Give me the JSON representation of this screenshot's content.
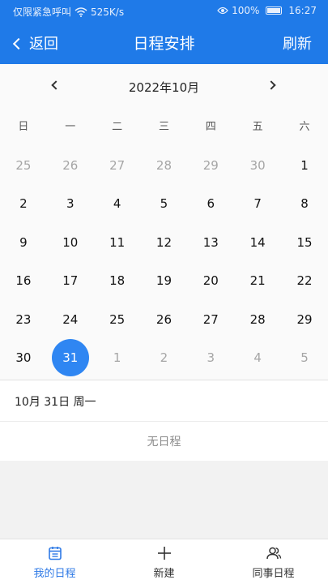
{
  "status_bar": {
    "carrier": "仅限紧急呼叫",
    "speed": "525K/s",
    "battery": "100%",
    "time": "16:27"
  },
  "header": {
    "back_label": "返回",
    "title": "日程安排",
    "refresh_label": "刷新"
  },
  "calendar": {
    "month_label": "2022年10月",
    "weekdays": [
      "日",
      "一",
      "二",
      "三",
      "四",
      "五",
      "六"
    ],
    "days": [
      {
        "d": "25",
        "other": true
      },
      {
        "d": "26",
        "other": true
      },
      {
        "d": "27",
        "other": true
      },
      {
        "d": "28",
        "other": true
      },
      {
        "d": "29",
        "other": true
      },
      {
        "d": "30",
        "other": true
      },
      {
        "d": "1"
      },
      {
        "d": "2"
      },
      {
        "d": "3"
      },
      {
        "d": "4"
      },
      {
        "d": "5"
      },
      {
        "d": "6"
      },
      {
        "d": "7"
      },
      {
        "d": "8"
      },
      {
        "d": "9"
      },
      {
        "d": "10"
      },
      {
        "d": "11"
      },
      {
        "d": "12"
      },
      {
        "d": "13"
      },
      {
        "d": "14"
      },
      {
        "d": "15"
      },
      {
        "d": "16"
      },
      {
        "d": "17"
      },
      {
        "d": "18"
      },
      {
        "d": "19"
      },
      {
        "d": "20"
      },
      {
        "d": "21"
      },
      {
        "d": "22"
      },
      {
        "d": "23"
      },
      {
        "d": "24"
      },
      {
        "d": "25"
      },
      {
        "d": "26"
      },
      {
        "d": "27"
      },
      {
        "d": "28"
      },
      {
        "d": "29"
      },
      {
        "d": "30"
      },
      {
        "d": "31",
        "selected": true
      },
      {
        "d": "1",
        "other": true
      },
      {
        "d": "2",
        "other": true
      },
      {
        "d": "3",
        "other": true
      },
      {
        "d": "4",
        "other": true
      },
      {
        "d": "5",
        "other": true
      }
    ]
  },
  "schedule": {
    "date_label": "10月 31日 周一",
    "empty_text": "无日程"
  },
  "bottom_nav": {
    "items": [
      {
        "label": "我的日程",
        "icon": "calendar-icon",
        "active": true
      },
      {
        "label": "新建",
        "icon": "plus-icon"
      },
      {
        "label": "同事日程",
        "icon": "people-icon"
      }
    ]
  },
  "colors": {
    "primary": "#1f7ae8",
    "selected": "#2f86f2",
    "nav_active": "#2f7ae6"
  }
}
